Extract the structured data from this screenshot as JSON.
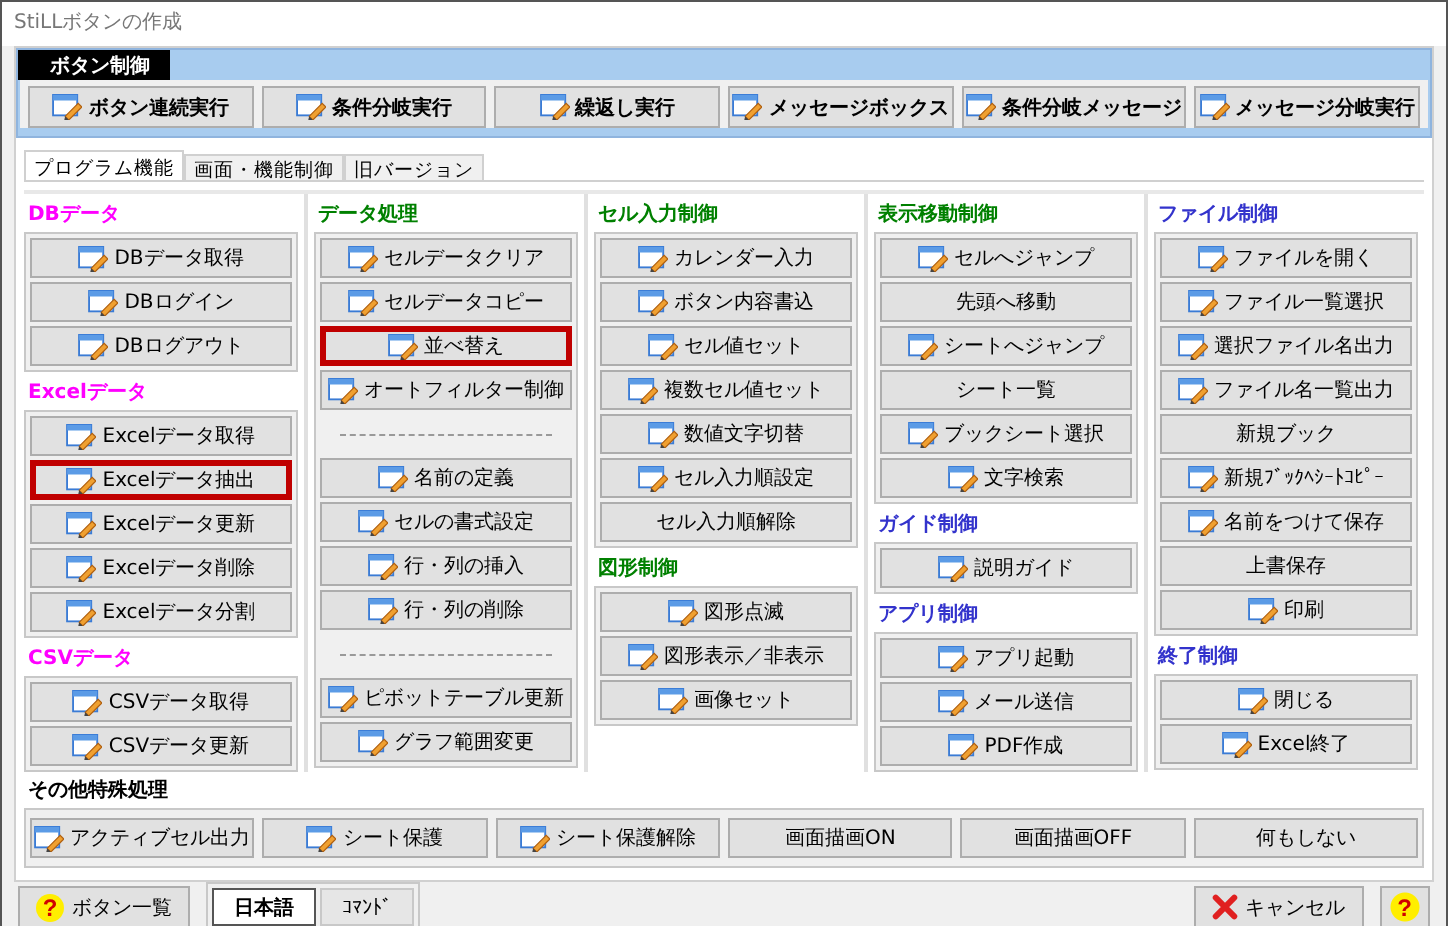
{
  "window": {
    "title": "StiLLボタンの作成"
  },
  "top_section": {
    "title": "ボタン制御",
    "buttons": [
      {
        "label": "ボタン連続実行",
        "icon": true
      },
      {
        "label": "条件分岐実行",
        "icon": true
      },
      {
        "label": "繰返し実行",
        "icon": true
      },
      {
        "label": "メッセージボックス",
        "icon": true
      },
      {
        "label": "条件分岐メッセージ",
        "icon": true
      },
      {
        "label": "メッセージ分岐実行",
        "icon": true
      }
    ]
  },
  "tabs": [
    {
      "label": "プログラム機能",
      "selected": true
    },
    {
      "label": "画面・機能制御",
      "selected": false
    },
    {
      "label": "旧バージョン",
      "selected": false
    }
  ],
  "columns": [
    {
      "groups": [
        {
          "title": "DBデータ",
          "color": "#ff00ff",
          "items": [
            {
              "kind": "button",
              "label": "DBデータ取得",
              "icon": true,
              "highlighted": false
            },
            {
              "kind": "button",
              "label": "DBログイン",
              "icon": true,
              "highlighted": false
            },
            {
              "kind": "button",
              "label": "DBログアウト",
              "icon": true,
              "highlighted": false
            }
          ]
        },
        {
          "title": "Excelデータ",
          "color": "#ff00ff",
          "items": [
            {
              "kind": "button",
              "label": "Excelデータ取得",
              "icon": true,
              "highlighted": false
            },
            {
              "kind": "button",
              "label": "Excelデータ抽出",
              "icon": true,
              "highlighted": true
            },
            {
              "kind": "button",
              "label": "Excelデータ更新",
              "icon": true,
              "highlighted": false
            },
            {
              "kind": "button",
              "label": "Excelデータ削除",
              "icon": true,
              "highlighted": false
            },
            {
              "kind": "button",
              "label": "Excelデータ分割",
              "icon": true,
              "highlighted": false
            }
          ]
        },
        {
          "title": "CSVデータ",
          "color": "#ff00ff",
          "items": [
            {
              "kind": "button",
              "label": "CSVデータ取得",
              "icon": true,
              "highlighted": false
            },
            {
              "kind": "button",
              "label": "CSVデータ更新",
              "icon": true,
              "highlighted": false
            }
          ]
        }
      ]
    },
    {
      "groups": [
        {
          "title": "データ処理",
          "color": "#008000",
          "items": [
            {
              "kind": "button",
              "label": "セルデータクリア",
              "icon": true,
              "highlighted": false
            },
            {
              "kind": "button",
              "label": "セルデータコピー",
              "icon": true,
              "highlighted": false
            },
            {
              "kind": "button",
              "label": "並べ替え",
              "icon": true,
              "highlighted": true
            },
            {
              "kind": "button",
              "label": "オートフィルター制御",
              "icon": true,
              "highlighted": false
            },
            {
              "kind": "separator"
            },
            {
              "kind": "button",
              "label": "名前の定義",
              "icon": true,
              "highlighted": false
            },
            {
              "kind": "button",
              "label": "セルの書式設定",
              "icon": true,
              "highlighted": false
            },
            {
              "kind": "button",
              "label": "行・列の挿入",
              "icon": true,
              "highlighted": false
            },
            {
              "kind": "button",
              "label": "行・列の削除",
              "icon": true,
              "highlighted": false
            },
            {
              "kind": "separator"
            },
            {
              "kind": "button",
              "label": "ピボットテーブル更新",
              "icon": true,
              "highlighted": false
            },
            {
              "kind": "button",
              "label": "グラフ範囲変更",
              "icon": true,
              "highlighted": false
            }
          ]
        }
      ]
    },
    {
      "groups": [
        {
          "title": "セル入力制御",
          "color": "#008000",
          "items": [
            {
              "kind": "button",
              "label": "カレンダー入力",
              "icon": true,
              "highlighted": false
            },
            {
              "kind": "button",
              "label": "ボタン内容書込",
              "icon": true,
              "highlighted": false
            },
            {
              "kind": "button",
              "label": "セル値セット",
              "icon": true,
              "highlighted": false
            },
            {
              "kind": "button",
              "label": "複数セル値セット",
              "icon": true,
              "highlighted": false
            },
            {
              "kind": "button",
              "label": "数値文字切替",
              "icon": true,
              "highlighted": false
            },
            {
              "kind": "button",
              "label": "セル入力順設定",
              "icon": true,
              "highlighted": false
            },
            {
              "kind": "button",
              "label": "セル入力順解除",
              "icon": false,
              "highlighted": false
            }
          ]
        },
        {
          "title": "図形制御",
          "color": "#008000",
          "items": [
            {
              "kind": "button",
              "label": "図形点滅",
              "icon": true,
              "highlighted": false
            },
            {
              "kind": "button",
              "label": "図形表示／非表示",
              "icon": true,
              "highlighted": false
            },
            {
              "kind": "button",
              "label": "画像セット",
              "icon": true,
              "highlighted": false
            }
          ]
        }
      ]
    },
    {
      "groups": [
        {
          "title": "表示移動制御",
          "color": "#008000",
          "items": [
            {
              "kind": "button",
              "label": "セルへジャンプ",
              "icon": true,
              "highlighted": false
            },
            {
              "kind": "button",
              "label": "先頭へ移動",
              "icon": false,
              "highlighted": false
            },
            {
              "kind": "button",
              "label": "シートへジャンプ",
              "icon": true,
              "highlighted": false
            },
            {
              "kind": "button",
              "label": "シート一覧",
              "icon": false,
              "highlighted": false
            },
            {
              "kind": "button",
              "label": "ブックシート選択",
              "icon": true,
              "highlighted": false
            },
            {
              "kind": "button",
              "label": "文字検索",
              "icon": true,
              "highlighted": false
            }
          ]
        },
        {
          "title": "ガイド制御",
          "color": "#3333cc",
          "items": [
            {
              "kind": "button",
              "label": "説明ガイド",
              "icon": true,
              "highlighted": false
            }
          ]
        },
        {
          "title": "アプリ制御",
          "color": "#3333cc",
          "items": [
            {
              "kind": "button",
              "label": "アプリ起動",
              "icon": true,
              "highlighted": false
            },
            {
              "kind": "button",
              "label": "メール送信",
              "icon": true,
              "highlighted": false
            },
            {
              "kind": "button",
              "label": "PDF作成",
              "icon": true,
              "highlighted": false
            }
          ]
        }
      ]
    },
    {
      "groups": [
        {
          "title": "ファイル制御",
          "color": "#3333cc",
          "items": [
            {
              "kind": "button",
              "label": "ファイルを開く",
              "icon": true,
              "highlighted": false
            },
            {
              "kind": "button",
              "label": "ファイル一覧選択",
              "icon": true,
              "highlighted": false
            },
            {
              "kind": "button",
              "label": "選択ファイル名出力",
              "icon": true,
              "highlighted": false
            },
            {
              "kind": "button",
              "label": "ファイル名一覧出力",
              "icon": true,
              "highlighted": false
            },
            {
              "kind": "button",
              "label": "新規ブック",
              "icon": false,
              "highlighted": false
            },
            {
              "kind": "button",
              "label": "新規ﾌﾞｯｸﾍｼｰﾄｺﾋﾟｰ",
              "icon": true,
              "highlighted": false
            },
            {
              "kind": "button",
              "label": "名前をつけて保存",
              "icon": true,
              "highlighted": false
            },
            {
              "kind": "button",
              "label": "上書保存",
              "icon": false,
              "highlighted": false
            },
            {
              "kind": "button",
              "label": "印刷",
              "icon": true,
              "highlighted": false
            }
          ]
        },
        {
          "title": "終了制御",
          "color": "#3333cc",
          "items": [
            {
              "kind": "button",
              "label": "閉じる",
              "icon": true,
              "highlighted": false
            },
            {
              "kind": "button",
              "label": "Excel終了",
              "icon": true,
              "highlighted": false
            }
          ]
        }
      ]
    }
  ],
  "other": {
    "title": "その他特殊処理",
    "buttons": [
      {
        "label": "アクティブセル出力",
        "icon": true
      },
      {
        "label": "シート保護",
        "icon": true
      },
      {
        "label": "シート保護解除",
        "icon": true
      },
      {
        "label": "画面描画ON",
        "icon": false
      },
      {
        "label": "画面描画OFF",
        "icon": false
      },
      {
        "label": "何もしない",
        "icon": false
      }
    ]
  },
  "footer": {
    "list_button": {
      "mark": "?",
      "label": "ボタン一覧"
    },
    "modes": [
      {
        "label": "日本語",
        "selected": true
      },
      {
        "label": "ｺﾏﾝﾄﾞ",
        "selected": false
      }
    ],
    "cancel_button": "キャンセル",
    "help_button": "?"
  }
}
